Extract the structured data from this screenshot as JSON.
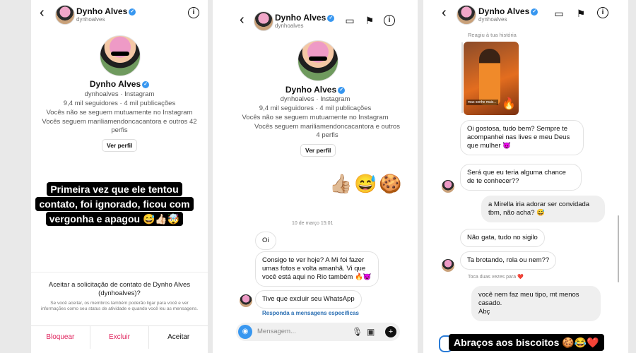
{
  "profile": {
    "name": "Dynho Alves",
    "username": "dynhoalves",
    "meta": "dynhoalves · Instagram",
    "counts": "9,4 mil seguidores · 4 mil publicações",
    "mutual": "Vocês não se seguem mutuamente no Instagram",
    "follows_p1": "Vocês seguem mariliamendoncacantora e outros 42 perfis",
    "follows_p2": "Vocês seguem mariliamendoncacantora e outros 4 perfis",
    "view_profile": "Ver perfil"
  },
  "panel1": {
    "caption_lines": [
      "Primeira vez que ele tentou",
      "contato, foi ignorado, ficou com",
      "vergonha e apagou 😅👍🏻🤯"
    ],
    "accept_title": "Aceitar a solicitação de contato de Dynho Alves (dynhoalves)?",
    "accept_sub": "Se você aceitar, os membros também poderão ligar para você e ver informações como seu status de atividade e quando você leu as mensagens.",
    "actions": {
      "block": "Bloquear",
      "delete": "Excluir",
      "accept": "Aceitar"
    }
  },
  "panel2": {
    "emojis": [
      "👍🏼",
      "😅",
      "🍪"
    ],
    "timestamp": "10 de março 15:01",
    "messages": [
      "Oi",
      "Consigo te ver hoje? A Mi foi fazer umas fotos e volta amanhã. Vi que você está aqui no Rio também 🔥😈",
      "Tive que excluir seu WhatsApp"
    ],
    "reply_link": "Responda a mensagens específicas",
    "composer_placeholder": "Mensagem..."
  },
  "panel3": {
    "reacted": "Reagiu à tua história",
    "messages": [
      {
        "text": "Oi gostosa, tudo bem? Sempre te acompanhei nas lives e meu Deus que mulher 😈",
        "side": "left"
      },
      {
        "text": "Será que eu teria alguma chance de te conhecer??",
        "side": "left"
      },
      {
        "text": "a Mirella iria adorar ser convidada tbm, não acha? 😅",
        "side": "right"
      },
      {
        "text": "Não gata, tudo no sigilo",
        "side": "left"
      },
      {
        "text": "Ta brotando, rola ou nem??",
        "side": "left"
      },
      {
        "text": "você nem faz meu tipo, mt menos casado.\nAbç",
        "side": "right"
      }
    ],
    "tap_like": "Toca duas vezes para ❤️",
    "bottom_caption": "Abraços aos biscoitos 🍪😂❤️",
    "story_label": "mas sonhe mais..."
  },
  "icons": [
    "back-arrow-icon",
    "verified-icon",
    "info-icon",
    "video-call-icon",
    "flag-icon",
    "camera-icon",
    "microphone-icon",
    "gallery-icon",
    "plus-icon"
  ]
}
